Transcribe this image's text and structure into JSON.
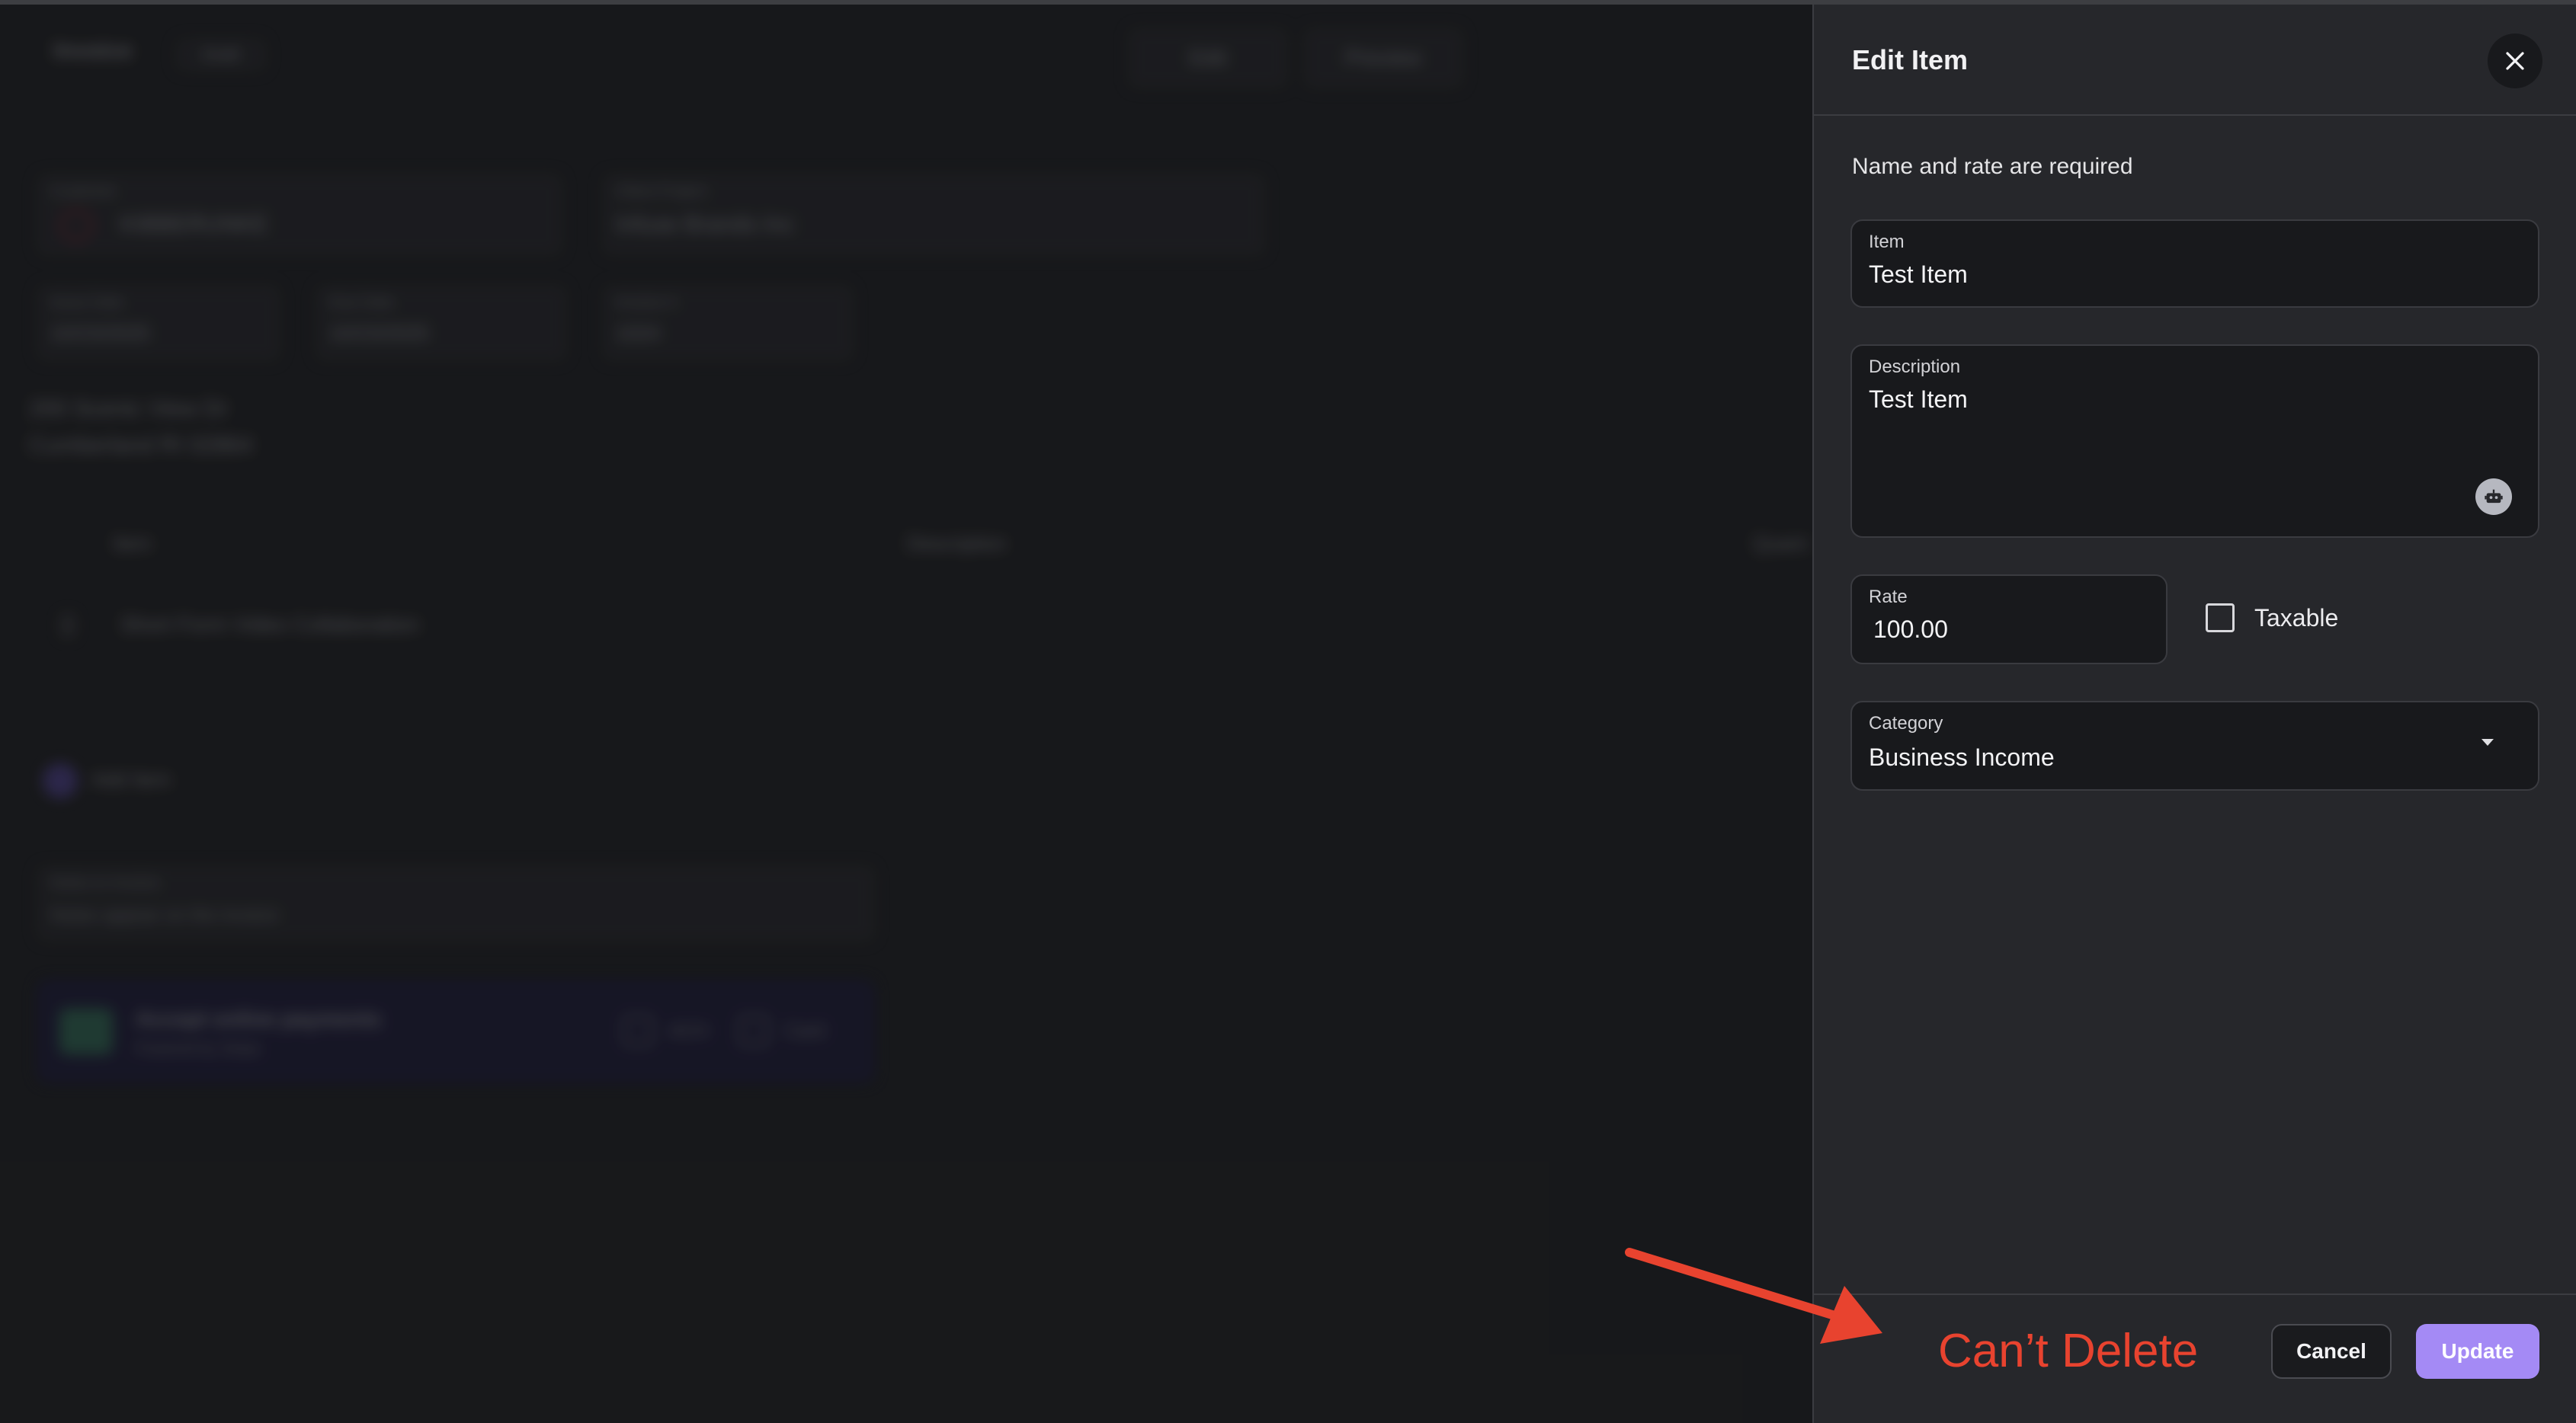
{
  "background": {
    "header_title": "Invoice",
    "header_badge": "Draft",
    "edit_button": "Edit",
    "preview_button": "Preview",
    "customer_label": "Customer",
    "customer_value": "KIBBERUNKE",
    "project_label": "Client Project",
    "project_value": "Infuse Brands Inc",
    "issue_date_label": "Issue Date",
    "issue_date_value": "10/23/2025",
    "due_date_label": "Due Date",
    "due_date_value": "10/23/2025",
    "invoice_num_label": "Invoice #",
    "invoice_num_value": "1024",
    "address_line1": "200 Scenic View Dr",
    "address_line2": "Cumberland RI 02864",
    "col_item": "Item",
    "col_description": "Description",
    "col_quantity": "Quant",
    "row_item": "Short Form Video Collaboration",
    "add_item": "Add Item",
    "notes_label": "Notes to Invoice",
    "notes_placeholder": "Notes appear on the invoice",
    "payments_title": "Accept online payments",
    "payments_sub": "Powered by Stripe",
    "payments_opt1": "ACH",
    "payments_opt2": "Card"
  },
  "drawer": {
    "title": "Edit Item",
    "hint": "Name and rate are required",
    "item_label": "Item",
    "item_value": "Test Item",
    "description_label": "Description",
    "description_value": "Test Item",
    "rate_label": "Rate",
    "rate_value": "100.00",
    "taxable_label": "Taxable",
    "taxable_checked": false,
    "category_label": "Category",
    "category_value": "Business Income",
    "cancel_label": "Cancel",
    "update_label": "Update"
  },
  "annotation": {
    "text": "Can’t Delete",
    "color": "#e8432f"
  },
  "colors": {
    "accent": "#a48af5",
    "panel": "#26272b",
    "field": "#18191c"
  }
}
